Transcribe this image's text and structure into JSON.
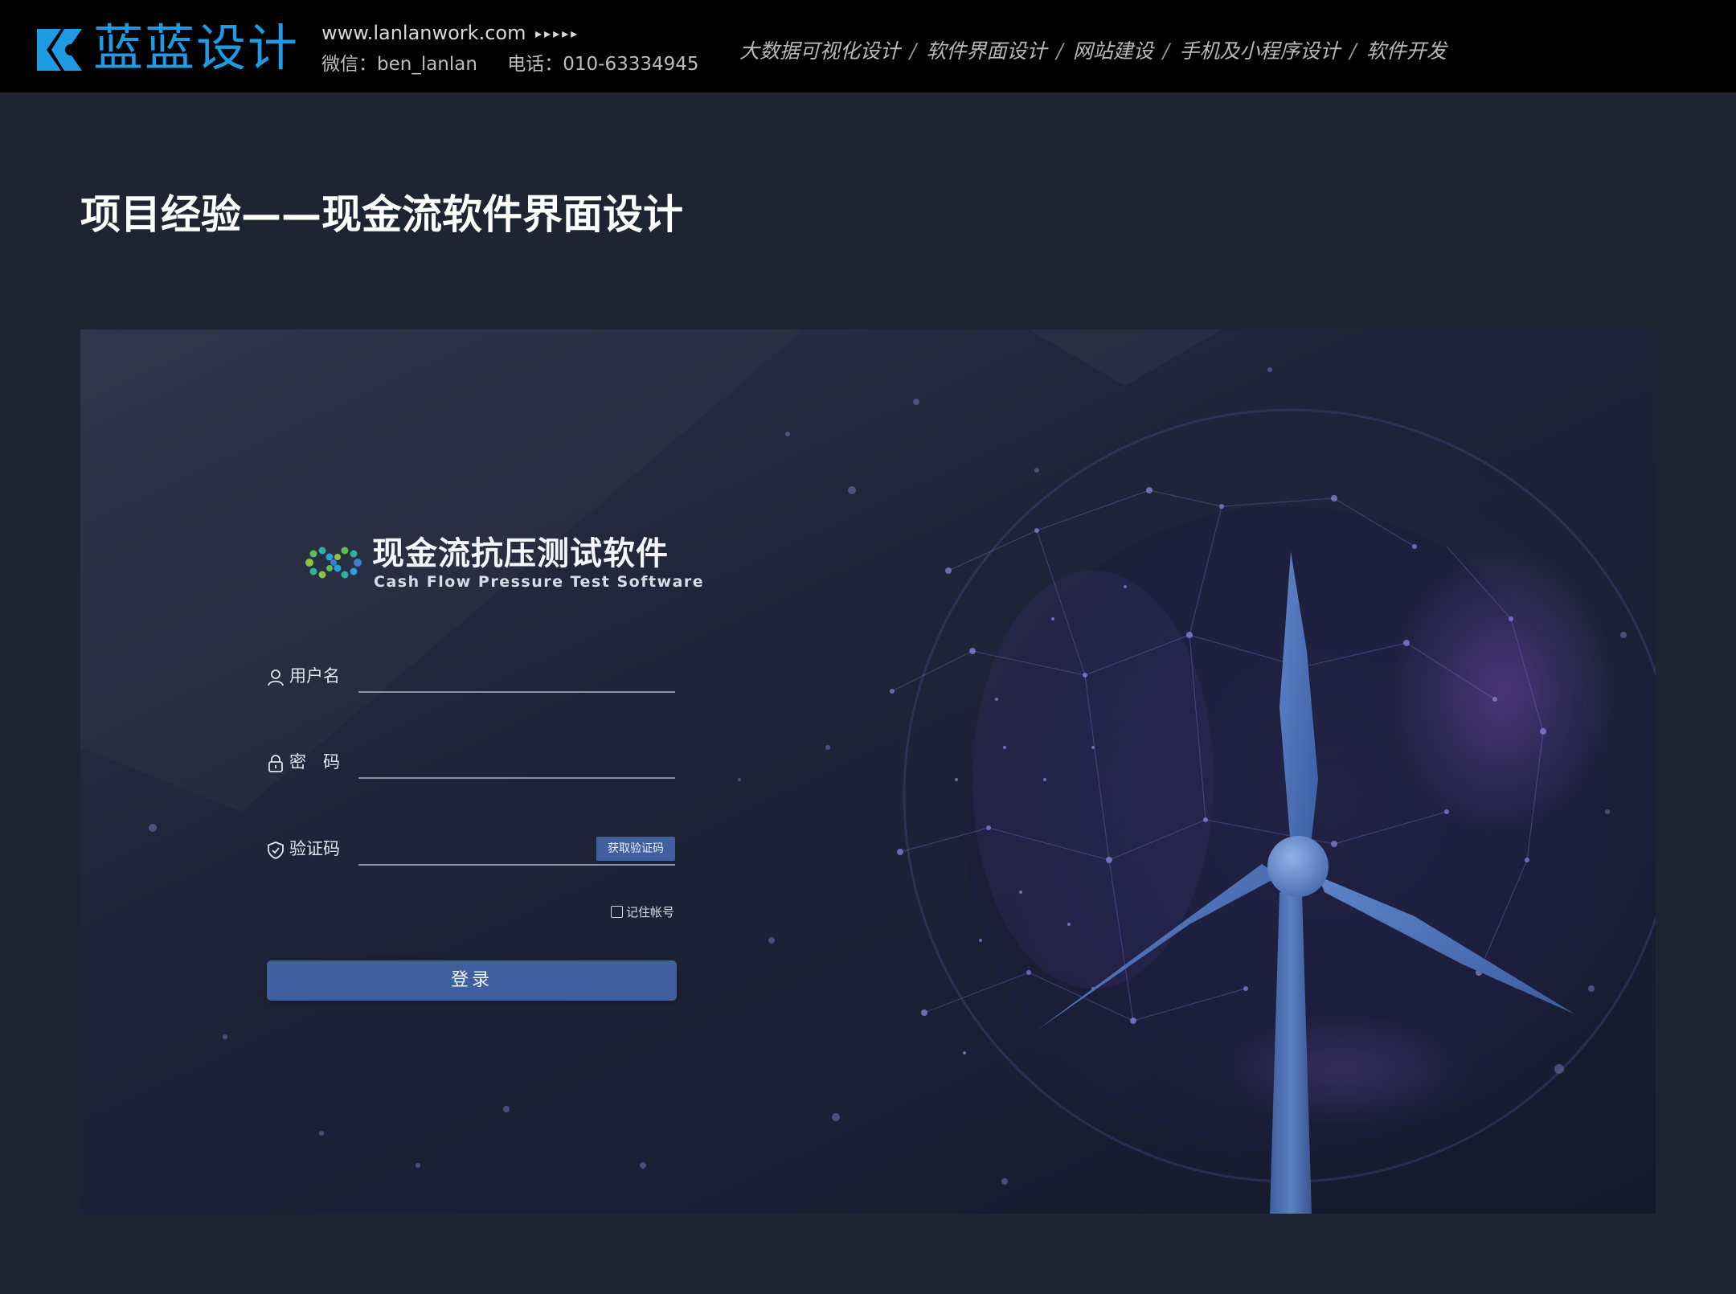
{
  "header": {
    "brand_name": "蓝蓝设计",
    "website": "www.lanlanwork.com",
    "arrows": "▸▸▸▸▸",
    "wechat": "微信：ben_lanlan",
    "phone": "电话：010-63334945",
    "services": [
      "大数据可视化设计",
      "软件界面设计",
      "网站建设",
      "手机及小程序设计",
      "软件开发"
    ],
    "separator": "/"
  },
  "page": {
    "title": "项目经验——现金流软件界面设计"
  },
  "login": {
    "product_name": "现金流抗压测试软件",
    "product_name_en": "Cash Flow Pressure Test Software",
    "username_label": "用户名",
    "password_label": "密　码",
    "captcha_label": "验证码",
    "captcha_button": "获取验证码",
    "remember_label": "记住帐号",
    "login_button": "登录"
  },
  "colors": {
    "brand_blue": "#1e9be3",
    "accent_button": "#3f5f9e",
    "page_bg": "#1f2433",
    "header_bg": "#000000"
  },
  "icons": {
    "brand": "brand-k-logo-icon",
    "product": "infinity-dots-logo-icon",
    "username": "user-icon",
    "password": "lock-icon",
    "captcha": "shield-check-icon"
  }
}
